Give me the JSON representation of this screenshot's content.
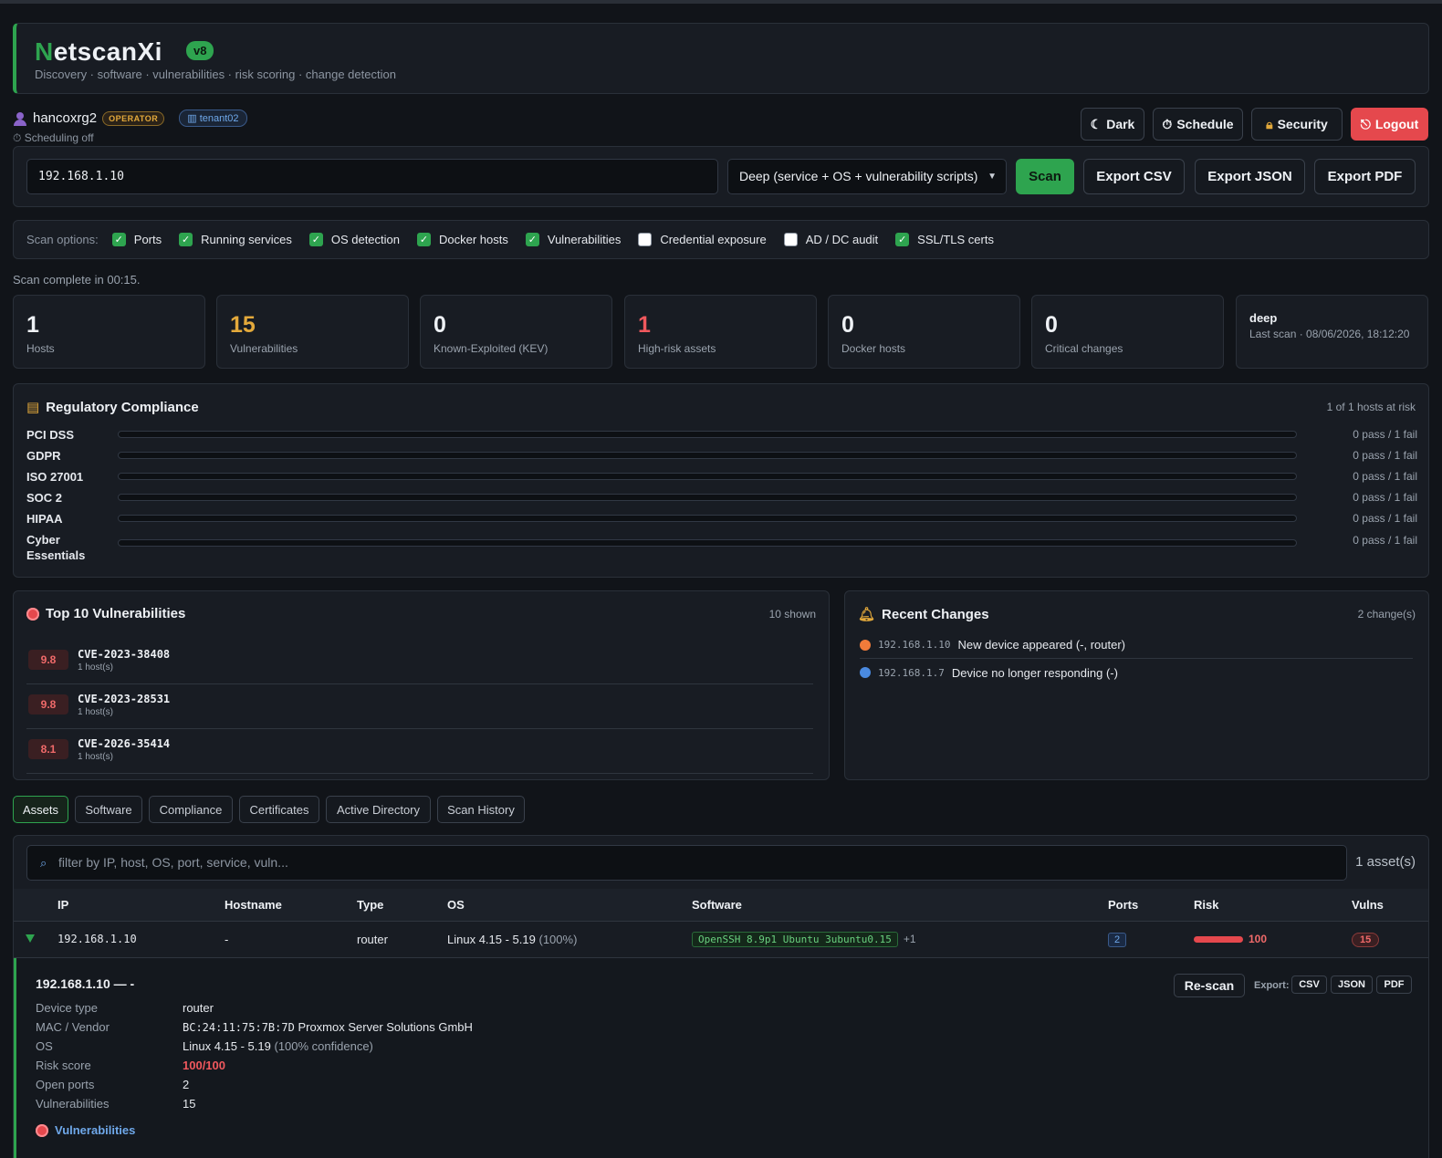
{
  "app": {
    "brand_first": "N",
    "brand_rest": "etscanXi",
    "version": "v8",
    "tagline": "Discovery · software · vulnerabilities · risk scoring · change detection",
    "accent": "#2ea44f"
  },
  "user": {
    "name": "hancoxrg2",
    "role": "OPERATOR",
    "tenant": "tenant02",
    "scheduling": "⏱ Scheduling off"
  },
  "top_buttons": {
    "dark": "Dark",
    "schedule": "Schedule",
    "security": "Security",
    "logout": "Logout"
  },
  "scan": {
    "target": "192.168.1.10",
    "mode": "Deep (service + OS + vulnerability scripts)",
    "scan_label": "Scan",
    "export_csv": "Export CSV",
    "export_json": "Export JSON",
    "export_pdf": "Export PDF"
  },
  "options": {
    "label": "Scan options:",
    "items": [
      {
        "label": "Ports",
        "checked": true
      },
      {
        "label": "Running services",
        "checked": true
      },
      {
        "label": "OS detection",
        "checked": true
      },
      {
        "label": "Docker hosts",
        "checked": true
      },
      {
        "label": "Vulnerabilities",
        "checked": true
      },
      {
        "label": "Credential exposure",
        "checked": false
      },
      {
        "label": "AD / DC audit",
        "checked": false
      },
      {
        "label": "SSL/TLS certs",
        "checked": true
      }
    ]
  },
  "status": "Scan complete in 00:15.",
  "stats": [
    {
      "value": "1",
      "label": "Hosts",
      "color": "#eef1f5"
    },
    {
      "value": "15",
      "label": "Vulnerabilities",
      "color": "#e3a93b"
    },
    {
      "value": "0",
      "label": "Known-Exploited (KEV)",
      "color": "#eef1f5"
    },
    {
      "value": "1",
      "label": "High-risk assets",
      "color": "#f0585d"
    },
    {
      "value": "0",
      "label": "Docker hosts",
      "color": "#eef1f5"
    },
    {
      "value": "0",
      "label": "Critical changes",
      "color": "#eef1f5"
    }
  ],
  "last_scan": {
    "mode": "deep",
    "text": "Last scan · 08/06/2026, 18:12:20"
  },
  "compliance": {
    "title": "Regulatory Compliance",
    "meta": "1 of 1 hosts at risk",
    "rows": [
      {
        "name": "PCI DSS",
        "result": "0 pass / 1 fail",
        "pass_fraction": 0
      },
      {
        "name": "GDPR",
        "result": "0 pass / 1 fail",
        "pass_fraction": 0
      },
      {
        "name": "ISO 27001",
        "result": "0 pass / 1 fail",
        "pass_fraction": 0
      },
      {
        "name": "SOC 2",
        "result": "0 pass / 1 fail",
        "pass_fraction": 0
      },
      {
        "name": "HIPAA",
        "result": "0 pass / 1 fail",
        "pass_fraction": 0
      },
      {
        "name": "Cyber Essentials",
        "result": "0 pass / 1 fail",
        "pass_fraction": 0
      }
    ]
  },
  "top_vulns": {
    "title": "Top 10 Vulnerabilities",
    "meta": "10 shown",
    "items": [
      {
        "score": "9.8",
        "cve": "CVE-2023-38408",
        "hosts": "1 host(s)"
      },
      {
        "score": "9.8",
        "cve": "CVE-2023-28531",
        "hosts": "1 host(s)"
      },
      {
        "score": "8.1",
        "cve": "CVE-2026-35414",
        "hosts": "1 host(s)"
      }
    ]
  },
  "changes": {
    "title": "Recent Changes",
    "meta": "2 change(s)",
    "items": [
      {
        "ip": "192.168.1.10",
        "text": "New device appeared (-, router)",
        "color": "#f07b3a"
      },
      {
        "ip": "192.168.1.7",
        "text": "Device no longer responding (-)",
        "color": "#4a8ae0"
      }
    ]
  },
  "tabs": [
    "Assets",
    "Software",
    "Compliance",
    "Certificates",
    "Active Directory",
    "Scan History"
  ],
  "assets": {
    "filter_placeholder": "filter by IP, host, OS, port, service, vuln...",
    "count": "1 asset(s)",
    "columns": [
      "IP",
      "Hostname",
      "Type",
      "OS",
      "Software",
      "Ports",
      "Risk",
      "Vulns"
    ],
    "rows": [
      {
        "ip": "192.168.1.10",
        "hostname": "-",
        "type": "router",
        "os": "Linux 4.15 - 5.19",
        "os_conf": "(100%)",
        "software": "OpenSSH 8.9p1 Ubuntu 3ubuntu0.15",
        "software_more": "+1",
        "ports": "2",
        "risk": "100",
        "vulns": "15"
      }
    ]
  },
  "detail": {
    "title": "192.168.1.10 — -",
    "rescan": "Re-scan",
    "export_label": "Export:",
    "export_csv": "CSV",
    "export_json": "JSON",
    "export_pdf": "PDF",
    "fields": [
      {
        "key": "Device type",
        "value": "router",
        "extra": ""
      },
      {
        "key": "MAC / Vendor",
        "mac": "BC:24:11:75:7B:7D",
        "value": "Proxmox Server Solutions GmbH",
        "extra": ""
      },
      {
        "key": "OS",
        "value": "Linux 4.15 - 5.19",
        "extra": "(100% confidence)"
      },
      {
        "key": "Risk score",
        "value": "100/100",
        "extra": ""
      },
      {
        "key": "Open ports",
        "value": "2",
        "extra": ""
      },
      {
        "key": "Vulnerabilities",
        "value": "15",
        "extra": ""
      }
    ],
    "vuln_heading": "Vulnerabilities"
  }
}
